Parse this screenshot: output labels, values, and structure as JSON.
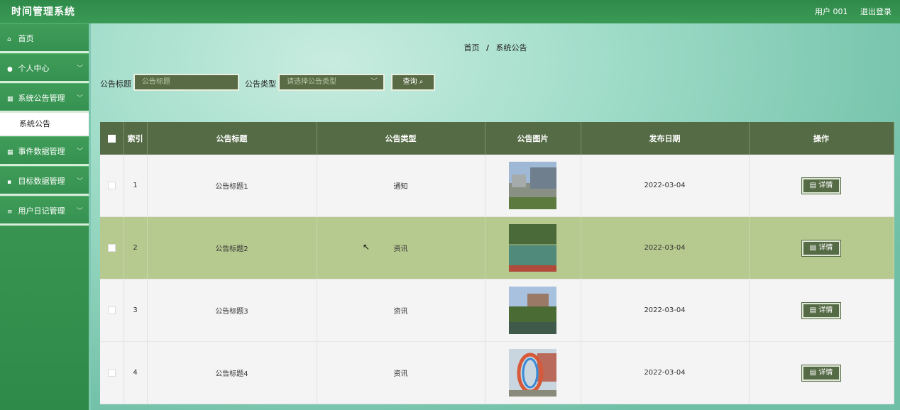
{
  "header": {
    "title": "时间管理系统",
    "user": "用户 001",
    "logout": "退出登录"
  },
  "sidebar": {
    "items": [
      {
        "label": "首页",
        "icon": "home-icon"
      },
      {
        "label": "个人中心",
        "icon": "user-icon"
      },
      {
        "label": "系统公告管理",
        "icon": "grid-icon"
      },
      {
        "label": "系统公告",
        "sub": true
      },
      {
        "label": "事件数据管理",
        "icon": "grid-icon"
      },
      {
        "label": "目标数据管理",
        "icon": "doc-icon"
      },
      {
        "label": "用户日记管理",
        "icon": "list-icon"
      }
    ]
  },
  "breadcrumb": {
    "home": "首页",
    "sep": "/",
    "current": "系统公告"
  },
  "search": {
    "title_label": "公告标题",
    "title_placeholder": "公告标题",
    "type_label": "公告类型",
    "type_placeholder": "请选择公告类型",
    "button": "查询 ⌕"
  },
  "table": {
    "headers": [
      "索引",
      "公告标题",
      "公告类型",
      "公告图片",
      "发布日期",
      "操作"
    ],
    "rows": [
      {
        "index": "1",
        "title": "公告标题1",
        "type": "通知",
        "date": "2022-03-04",
        "action": "▤ 详情"
      },
      {
        "index": "2",
        "title": "公告标题2",
        "type": "资讯",
        "date": "2022-03-04",
        "action": "▤ 详情"
      },
      {
        "index": "3",
        "title": "公告标题3",
        "type": "资讯",
        "date": "2022-03-04",
        "action": "▤ 详情"
      },
      {
        "index": "4",
        "title": "公告标题4",
        "type": "资讯",
        "date": "2022-03-04",
        "action": "▤ 详情"
      }
    ]
  },
  "colors": {
    "accent": "#556b45",
    "topbar": "#2f8a4a",
    "sidebar": "#3a9a55",
    "row_highlight": "#b6c98f"
  }
}
